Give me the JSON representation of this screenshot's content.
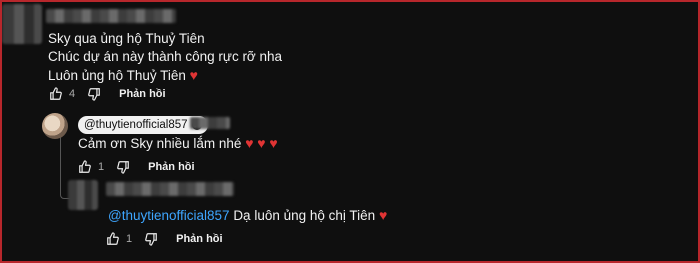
{
  "comment": {
    "lines": [
      "Sky qua ủng hộ Thuỷ Tiên",
      "Chúc dự án này thành công rực rỡ nha",
      "Luôn ủng hộ Thuỷ Tiên"
    ],
    "heart": "♥",
    "likes": "4",
    "reply_label": "Phản hồi"
  },
  "reply1": {
    "channel": "@thuytienofficial857",
    "verified": "✓",
    "text": "Cảm ơn Sky nhiều lắm nhé",
    "hearts": [
      "♥",
      "♥",
      "♥"
    ],
    "likes": "1",
    "reply_label": "Phản hồi"
  },
  "reply2": {
    "mention": "@thuytienofficial857",
    "text": "Dạ luôn ủng hộ chị Tiên",
    "heart": "♥",
    "likes": "1",
    "reply_label": "Phản hồi"
  },
  "icons": {
    "like": "thumb-up-icon",
    "dislike": "thumb-down-icon"
  },
  "colors": {
    "background": "#0f0f0f",
    "heart": "#e03434",
    "mention": "#3ea6ff",
    "frame": "#b8272c"
  }
}
